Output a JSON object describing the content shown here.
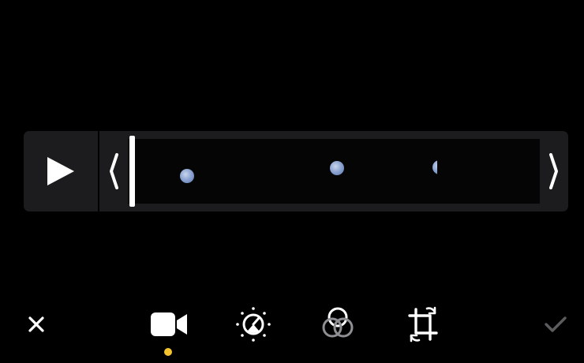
{
  "editor": {
    "mode": "video-edit",
    "accent_color": "#f4c430",
    "background_color": "#000000",
    "panel_color": "#1c1c1e"
  },
  "timeline": {
    "play_icon": "play-icon",
    "trim_left_icon": "chevron-left-icon",
    "trim_right_icon": "chevron-right-icon",
    "playhead_position": 0.01,
    "frames": [
      "moon-frame",
      "moon-frame",
      "moon-frame"
    ]
  },
  "toolbar": {
    "items": [
      {
        "icon": "close-icon"
      },
      {
        "icon": "video-camera-icon",
        "active": true
      },
      {
        "icon": "adjust-dial-icon"
      },
      {
        "icon": "filters-icon"
      },
      {
        "icon": "crop-rotate-icon"
      },
      {
        "icon": "checkmark-icon",
        "enabled": false
      }
    ]
  }
}
